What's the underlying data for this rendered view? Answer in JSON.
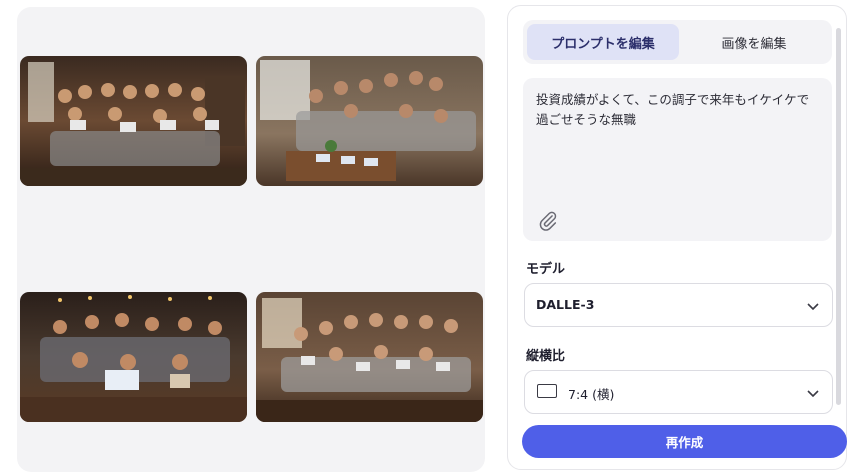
{
  "gallery": {
    "images": [
      {
        "icon": "generated-image"
      },
      {
        "icon": "generated-image"
      },
      {
        "icon": "generated-image"
      },
      {
        "icon": "generated-image"
      }
    ]
  },
  "editor": {
    "tabs": [
      {
        "label": "プロンプトを編集",
        "active": true
      },
      {
        "label": "画像を編集",
        "active": false
      }
    ],
    "prompt": {
      "value": "投資成績がよくて、この調子で来年もイケイケで過ごせそうな無職",
      "attach_icon": "paperclip-icon"
    },
    "model": {
      "label": "モデル",
      "value": "DALLE-3"
    },
    "aspect": {
      "label": "縦横比",
      "value": "7:4 (横)"
    },
    "submit_label": "再作成"
  },
  "colors": {
    "accent": "#4f5fe8",
    "active_tab_bg": "#dfe2f6",
    "panel_bg": "#f3f3f5"
  }
}
